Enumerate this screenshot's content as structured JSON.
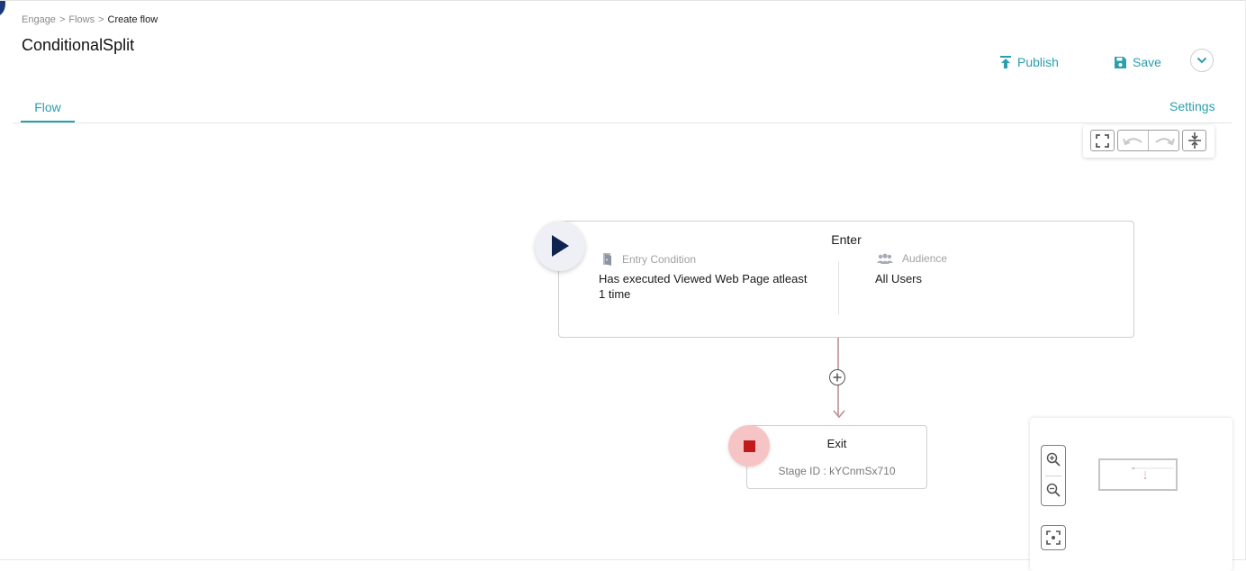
{
  "breadcrumb": {
    "item1": "Engage",
    "item2": "Flows",
    "current": "Create flow",
    "sep": ">"
  },
  "page": {
    "title": "ConditionalSplit"
  },
  "actions": {
    "publish": "Publish",
    "save": "Save"
  },
  "tabs": {
    "flow": "Flow",
    "settings": "Settings"
  },
  "enter_node": {
    "title": "Enter",
    "entry_condition_label": "Entry Condition",
    "entry_condition_line1": "Has executed Viewed Web Page atleast",
    "entry_condition_line2": "1 time",
    "audience_label": "Audience",
    "audience_value": "All Users"
  },
  "exit_node": {
    "title": "Exit",
    "stage": "Stage ID : kYCnmSx710"
  },
  "colors": {
    "accent": "#2a9fad",
    "stop": "#c21a1a",
    "play": "#0f2350"
  },
  "icons": [
    "fullscreen-icon",
    "undo-icon",
    "redo-icon",
    "collapse-icon",
    "door-icon",
    "users-icon",
    "play-icon",
    "stop-icon",
    "plus-icon",
    "zoom-in-icon",
    "zoom-out-icon",
    "focus-icon",
    "upload-icon",
    "floppy-icon",
    "chevron-down-icon"
  ]
}
